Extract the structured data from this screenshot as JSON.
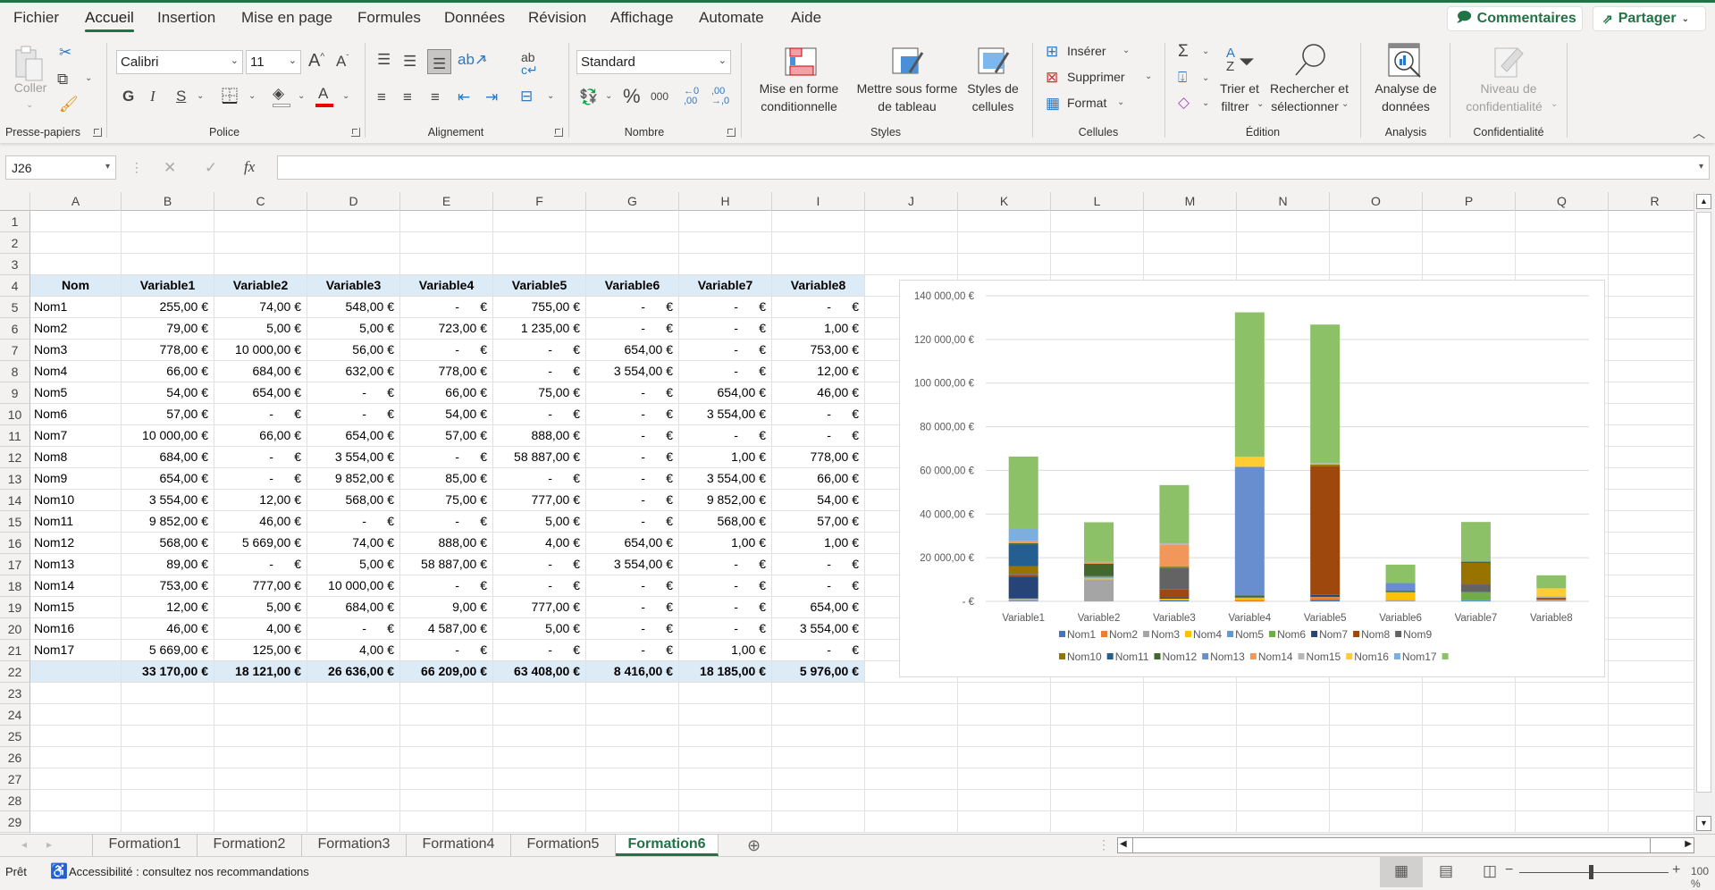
{
  "app": {
    "accent": "#217346"
  },
  "menu": {
    "tabs": [
      "Fichier",
      "Accueil",
      "Insertion",
      "Mise en page",
      "Formules",
      "Données",
      "Révision",
      "Affichage",
      "Automate",
      "Aide"
    ],
    "active": "Accueil",
    "comments": "Commentaires",
    "share": "Partager"
  },
  "ribbon": {
    "clipboard": {
      "paste": "Coller",
      "group": "Presse-papiers"
    },
    "font": {
      "name": "Calibri",
      "size": "11",
      "bold": "G",
      "italic": "I",
      "underline": "S",
      "group": "Police"
    },
    "alignment": {
      "group": "Alignement"
    },
    "number": {
      "format": "Standard",
      "percent": "%",
      "thousands": "000",
      "group": "Nombre"
    },
    "styles": {
      "conditional": [
        "Mise en forme",
        "conditionnelle"
      ],
      "table": [
        "Mettre sous forme",
        "de tableau"
      ],
      "cell_styles": [
        "Styles de",
        "cellules"
      ],
      "group": "Styles"
    },
    "cells": {
      "insert": "Insérer",
      "delete": "Supprimer",
      "format": "Format",
      "group": "Cellules"
    },
    "editing": {
      "sort": [
        "Trier et",
        "filtrer"
      ],
      "find": [
        "Rechercher et",
        "sélectionner"
      ],
      "group": "Édition"
    },
    "analysis": {
      "label": [
        "Analyse de",
        "données"
      ],
      "group": "Analysis"
    },
    "sensitivity": {
      "label": [
        "Niveau de",
        "confidentialité"
      ],
      "group": "Confidentialité"
    }
  },
  "formula_bar": {
    "name_box": "J26",
    "fx": "fx",
    "formula": ""
  },
  "columns": [
    "A",
    "B",
    "C",
    "D",
    "E",
    "F",
    "G",
    "H",
    "I",
    "J",
    "K",
    "L",
    "M",
    "N",
    "O",
    "P",
    "Q",
    "R"
  ],
  "row_numbers": [
    "1",
    "2",
    "3",
    "4",
    "5",
    "6",
    "7",
    "8",
    "9",
    "10",
    "11",
    "12",
    "13",
    "14",
    "15",
    "16",
    "17",
    "18",
    "19",
    "20",
    "21",
    "22",
    "23",
    "24",
    "25",
    "26",
    "27",
    "28",
    "29"
  ],
  "table": {
    "headers": [
      "Nom",
      "Variable1",
      "Variable2",
      "Variable3",
      "Variable4",
      "Variable5",
      "Variable6",
      "Variable7",
      "Variable8"
    ],
    "rows": [
      {
        "name": "Nom1",
        "values": [
          "255,00 €",
          "74,00 €",
          "548,00 €",
          "-      €",
          "755,00 €",
          "-      €",
          "-      €",
          "-      €"
        ]
      },
      {
        "name": "Nom2",
        "values": [
          "79,00 €",
          "5,00 €",
          "5,00 €",
          "723,00 €",
          "1 235,00 €",
          "-      €",
          "-      €",
          "1,00 €"
        ]
      },
      {
        "name": "Nom3",
        "values": [
          "778,00 €",
          "10 000,00 €",
          "56,00 €",
          "-      €",
          "-      €",
          "654,00 €",
          "-      €",
          "753,00 €"
        ]
      },
      {
        "name": "Nom4",
        "values": [
          "66,00 €",
          "684,00 €",
          "632,00 €",
          "778,00 €",
          "-      €",
          "3 554,00 €",
          "-      €",
          "12,00 €"
        ]
      },
      {
        "name": "Nom5",
        "values": [
          "54,00 €",
          "654,00 €",
          "-      €",
          "66,00 €",
          "75,00 €",
          "-      €",
          "654,00 €",
          "46,00 €"
        ]
      },
      {
        "name": "Nom6",
        "values": [
          "57,00 €",
          "-      €",
          "-      €",
          "54,00 €",
          "-      €",
          "-      €",
          "3 554,00 €",
          "-      €"
        ]
      },
      {
        "name": "Nom7",
        "values": [
          "10 000,00 €",
          "66,00 €",
          "654,00 €",
          "57,00 €",
          "888,00 €",
          "-      €",
          "-      €",
          "-      €"
        ]
      },
      {
        "name": "Nom8",
        "values": [
          "684,00 €",
          "-      €",
          "3 554,00 €",
          "-      €",
          "58 887,00 €",
          "-      €",
          "1,00 €",
          "778,00 €"
        ]
      },
      {
        "name": "Nom9",
        "values": [
          "654,00 €",
          "-      €",
          "9 852,00 €",
          "85,00 €",
          "-      €",
          "-      €",
          "3 554,00 €",
          "66,00 €"
        ]
      },
      {
        "name": "Nom10",
        "values": [
          "3 554,00 €",
          "12,00 €",
          "568,00 €",
          "75,00 €",
          "777,00 €",
          "-      €",
          "9 852,00 €",
          "54,00 €"
        ]
      },
      {
        "name": "Nom11",
        "values": [
          "9 852,00 €",
          "46,00 €",
          "-      €",
          "-      €",
          "5,00 €",
          "-      €",
          "568,00 €",
          "57,00 €"
        ]
      },
      {
        "name": "Nom12",
        "values": [
          "568,00 €",
          "5 669,00 €",
          "74,00 €",
          "888,00 €",
          "4,00 €",
          "654,00 €",
          "1,00 €",
          "1,00 €"
        ]
      },
      {
        "name": "Nom13",
        "values": [
          "89,00 €",
          "-      €",
          "5,00 €",
          "58 887,00 €",
          "-      €",
          "3 554,00 €",
          "-      €",
          "-      €"
        ]
      },
      {
        "name": "Nom14",
        "values": [
          "753,00 €",
          "777,00 €",
          "10 000,00 €",
          "-      €",
          "-      €",
          "-      €",
          "-      €",
          "-      €"
        ]
      },
      {
        "name": "Nom15",
        "values": [
          "12,00 €",
          "5,00 €",
          "684,00 €",
          "9,00 €",
          "777,00 €",
          "-      €",
          "-      €",
          "654,00 €"
        ]
      },
      {
        "name": "Nom16",
        "values": [
          "46,00 €",
          "4,00 €",
          "-      €",
          "4 587,00 €",
          "5,00 €",
          "-      €",
          "-      €",
          "3 554,00 €"
        ]
      },
      {
        "name": "Nom17",
        "values": [
          "5 669,00 €",
          "125,00 €",
          "4,00 €",
          "-      €",
          "-      €",
          "-      €",
          "1,00 €",
          "-      €"
        ]
      }
    ],
    "totals": [
      "33 170,00 €",
      "18 121,00 €",
      "26 636,00 €",
      "66 209,00 €",
      "63 408,00 €",
      "8 416,00 €",
      "18 185,00 €",
      "5 976,00 €"
    ],
    "header_fill": "#ddebf7"
  },
  "chart_data": {
    "type": "bar",
    "stacked": true,
    "categories": [
      "Variable1",
      "Variable2",
      "Variable3",
      "Variable4",
      "Variable5",
      "Variable6",
      "Variable7",
      "Variable8"
    ],
    "ylim": [
      0,
      140000
    ],
    "yticks": [
      0,
      20000,
      40000,
      60000,
      80000,
      100000,
      120000,
      140000
    ],
    "ytick_labels": [
      "-  €",
      "20 000,00 €",
      "40 000,00 €",
      "60 000,00 €",
      "80 000,00 €",
      "100 000,00 €",
      "120 000,00 €",
      "140 000,00 €"
    ],
    "grid": true,
    "legend": "bottom",
    "series": [
      {
        "name": "Nom1",
        "color": "#4472c4",
        "values": [
          255,
          74,
          548,
          0,
          755,
          0,
          0,
          0
        ]
      },
      {
        "name": "Nom2",
        "color": "#ed7d31",
        "values": [
          79,
          5,
          5,
          723,
          1235,
          0,
          0,
          1
        ]
      },
      {
        "name": "Nom3",
        "color": "#a5a5a5",
        "values": [
          778,
          10000,
          56,
          0,
          0,
          654,
          0,
          753
        ]
      },
      {
        "name": "Nom4",
        "color": "#ffc000",
        "values": [
          66,
          684,
          632,
          778,
          0,
          3554,
          0,
          12
        ]
      },
      {
        "name": "Nom5",
        "color": "#5b9bd5",
        "values": [
          54,
          654,
          0,
          66,
          75,
          0,
          654,
          46
        ]
      },
      {
        "name": "Nom6",
        "color": "#70ad47",
        "values": [
          57,
          0,
          0,
          54,
          0,
          0,
          3554,
          0
        ]
      },
      {
        "name": "Nom7",
        "color": "#264478",
        "values": [
          10000,
          66,
          654,
          57,
          888,
          0,
          0,
          0
        ]
      },
      {
        "name": "Nom8",
        "color": "#9e480e",
        "values": [
          684,
          0,
          3554,
          0,
          58887,
          0,
          1,
          778
        ]
      },
      {
        "name": "Nom9",
        "color": "#636363",
        "values": [
          654,
          0,
          9852,
          85,
          0,
          0,
          3554,
          66
        ]
      },
      {
        "name": "Nom10",
        "color": "#997300",
        "values": [
          3554,
          12,
          568,
          75,
          777,
          0,
          9852,
          54
        ]
      },
      {
        "name": "Nom11",
        "color": "#255e91",
        "values": [
          9852,
          46,
          0,
          0,
          5,
          0,
          568,
          57
        ]
      },
      {
        "name": "Nom12",
        "color": "#43682b",
        "values": [
          568,
          5669,
          74,
          888,
          4,
          654,
          1,
          1
        ]
      },
      {
        "name": "Nom13",
        "color": "#698ed0",
        "values": [
          89,
          0,
          5,
          58887,
          0,
          3554,
          0,
          0
        ]
      },
      {
        "name": "Nom14",
        "color": "#f1975a",
        "values": [
          753,
          777,
          10000,
          0,
          0,
          0,
          0,
          0
        ]
      },
      {
        "name": "Nom15",
        "color": "#b7b7b7",
        "values": [
          12,
          5,
          684,
          9,
          777,
          0,
          0,
          654
        ]
      },
      {
        "name": "Nom16",
        "color": "#ffcd33",
        "values": [
          46,
          4,
          0,
          4587,
          5,
          0,
          0,
          3554
        ]
      },
      {
        "name": "Nom17",
        "color": "#7cafdd",
        "values": [
          5669,
          125,
          4,
          0,
          0,
          0,
          1,
          0
        ]
      },
      {
        "name": "",
        "color": "#8cc168",
        "values": [
          33170,
          18121,
          26636,
          66209,
          63408,
          8416,
          18185,
          5976
        ]
      }
    ]
  },
  "sheets": {
    "tabs": [
      "Formation1",
      "Formation2",
      "Formation3",
      "Formation4",
      "Formation5",
      "Formation6"
    ],
    "active": "Formation6"
  },
  "status": {
    "ready": "Prêt",
    "accessibility": "Accessibilité : consultez nos recommandations",
    "zoom": "100 %",
    "zoom_percent": 100
  }
}
